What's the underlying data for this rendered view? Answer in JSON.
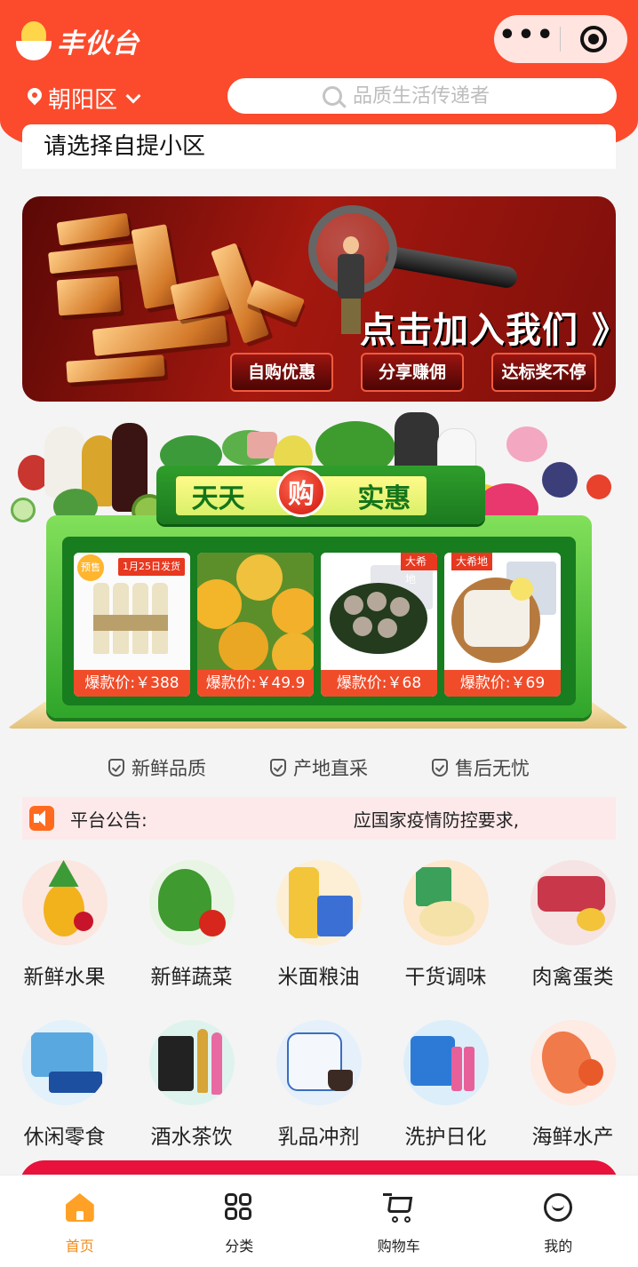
{
  "app": {
    "name": "丰伙台"
  },
  "header": {
    "location": "朝阳区",
    "search_placeholder": "品质生活传递者",
    "pickup_prompt": "请选择自提小区",
    "menu_more": "•••",
    "accent_color": "#fb4b2c"
  },
  "banner": {
    "headline": "点击加入我们 》",
    "tags": [
      "自购优惠",
      "分享赚佣",
      "达标奖不停"
    ]
  },
  "promo": {
    "title_left": "天天",
    "title_mid": "购",
    "title_right": "实惠",
    "products": [
      {
        "price_label": "爆款价:￥388",
        "badge": "预售",
        "ship_tag": "1月25日发货"
      },
      {
        "price_label": "爆款价:￥49.9"
      },
      {
        "price_label": "爆款价:￥68",
        "brand_tag": "大希地"
      },
      {
        "price_label": "爆款价:￥69",
        "brand_tag": "大希地"
      }
    ]
  },
  "features": [
    "新鲜品质",
    "产地直采",
    "售后无忧"
  ],
  "notice": {
    "label": "平台公告:",
    "text": "应国家疫情防控要求,"
  },
  "categories": [
    {
      "label": "新鲜水果",
      "icon": "fruit-icon"
    },
    {
      "label": "新鲜蔬菜",
      "icon": "vegetable-icon"
    },
    {
      "label": "米面粮油",
      "icon": "grain-oil-icon"
    },
    {
      "label": "干货调味",
      "icon": "seasoning-icon"
    },
    {
      "label": "肉禽蛋类",
      "icon": "meat-egg-icon"
    },
    {
      "label": "休闲零食",
      "icon": "snack-icon"
    },
    {
      "label": "酒水茶饮",
      "icon": "drinks-icon"
    },
    {
      "label": "乳品冲剂",
      "icon": "dairy-icon"
    },
    {
      "label": "洗护日化",
      "icon": "toiletries-icon"
    },
    {
      "label": "海鲜水产",
      "icon": "seafood-icon"
    }
  ],
  "tabbar": [
    {
      "label": "首页",
      "icon": "home-icon",
      "active": true
    },
    {
      "label": "分类",
      "icon": "category-icon",
      "active": false
    },
    {
      "label": "购物车",
      "icon": "cart-icon",
      "active": false
    },
    {
      "label": "我的",
      "icon": "profile-icon",
      "active": false
    }
  ]
}
